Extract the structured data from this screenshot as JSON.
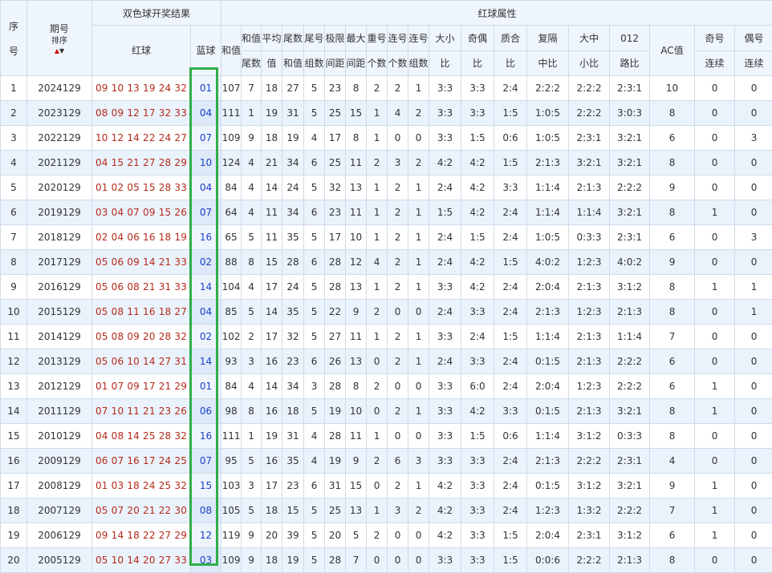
{
  "header": {
    "seq_top": "序",
    "seq_bottom": "号",
    "issue": "期号",
    "sort_label": "排序",
    "draw_result": "双色球开奖结果",
    "red_attr": "红球属性",
    "red_ball": "红球",
    "blue_ball": "蓝球",
    "sum_top": "和值",
    "sum_tail_top": "和值",
    "sum_tail_bottom": "尾数",
    "avg_top": "平均",
    "avg_bottom": "值",
    "tail_sum_top": "尾数",
    "tail_sum_bottom": "和值",
    "tail_group_top": "尾号",
    "tail_group_bottom": "组数",
    "span_top": "极限",
    "span_bottom": "间距",
    "maxgap_top": "最大",
    "maxgap_bottom": "间距",
    "repeat_top": "重号",
    "repeat_bottom": "个数",
    "consec_top": "连号",
    "consec_bottom": "个数",
    "consec_group_top": "连号",
    "consec_group_bottom": "组数",
    "bigsmall_top": "大小",
    "bigsmall_bottom": "比",
    "oddeven_top": "奇偶",
    "oddeven_bottom": "比",
    "primecomp_top": "质合",
    "primecomp_bottom": "比",
    "repeatmid_top": "复隔",
    "repeatmid_bottom": "中比",
    "bigmid_top": "大中",
    "bigmid_bottom": "小比",
    "route_top": "012",
    "route_bottom": "路比",
    "ac": "AC值",
    "oddrun_top": "奇号",
    "oddrun_bottom": "连续",
    "evenrun_top": "偶号",
    "evenrun_bottom": "连续"
  },
  "rows": [
    {
      "seq": "1",
      "issue": "2024129",
      "red": "09 10 13 19 24 32",
      "blue": "01",
      "sum": "107",
      "sum_tail": "7",
      "avg": "18",
      "tail_sum": "27",
      "tail_groups": "5",
      "span": "23",
      "max_gap": "8",
      "repeat": "2",
      "consec": "2",
      "consec_groups": "1",
      "big_small": "3:3",
      "odd_even": "3:3",
      "prime_comp": "2:4",
      "rep_mid": "2:2:2",
      "big_mid_small": "2:2:2",
      "route": "2:3:1",
      "ac": "10",
      "odd_run": "0",
      "even_run": "0"
    },
    {
      "seq": "2",
      "issue": "2023129",
      "red": "08 09 12 17 32 33",
      "blue": "04",
      "sum": "111",
      "sum_tail": "1",
      "avg": "19",
      "tail_sum": "31",
      "tail_groups": "5",
      "span": "25",
      "max_gap": "15",
      "repeat": "1",
      "consec": "4",
      "consec_groups": "2",
      "big_small": "3:3",
      "odd_even": "3:3",
      "prime_comp": "1:5",
      "rep_mid": "1:0:5",
      "big_mid_small": "2:2:2",
      "route": "3:0:3",
      "ac": "8",
      "odd_run": "0",
      "even_run": "0"
    },
    {
      "seq": "3",
      "issue": "2022129",
      "red": "10 12 14 22 24 27",
      "blue": "07",
      "sum": "109",
      "sum_tail": "9",
      "avg": "18",
      "tail_sum": "19",
      "tail_groups": "4",
      "span": "17",
      "max_gap": "8",
      "repeat": "1",
      "consec": "0",
      "consec_groups": "0",
      "big_small": "3:3",
      "odd_even": "1:5",
      "prime_comp": "0:6",
      "rep_mid": "1:0:5",
      "big_mid_small": "2:3:1",
      "route": "3:2:1",
      "ac": "6",
      "odd_run": "0",
      "even_run": "3"
    },
    {
      "seq": "4",
      "issue": "2021129",
      "red": "04 15 21 27 28 29",
      "blue": "10",
      "sum": "124",
      "sum_tail": "4",
      "avg": "21",
      "tail_sum": "34",
      "tail_groups": "6",
      "span": "25",
      "max_gap": "11",
      "repeat": "2",
      "consec": "3",
      "consec_groups": "2",
      "big_small": "4:2",
      "odd_even": "4:2",
      "prime_comp": "1:5",
      "rep_mid": "2:1:3",
      "big_mid_small": "3:2:1",
      "route": "3:2:1",
      "ac": "8",
      "odd_run": "0",
      "even_run": "0"
    },
    {
      "seq": "5",
      "issue": "2020129",
      "red": "01 02 05 15 28 33",
      "blue": "04",
      "sum": "84",
      "sum_tail": "4",
      "avg": "14",
      "tail_sum": "24",
      "tail_groups": "5",
      "span": "32",
      "max_gap": "13",
      "repeat": "1",
      "consec": "2",
      "consec_groups": "1",
      "big_small": "2:4",
      "odd_even": "4:2",
      "prime_comp": "3:3",
      "rep_mid": "1:1:4",
      "big_mid_small": "2:1:3",
      "route": "2:2:2",
      "ac": "9",
      "odd_run": "0",
      "even_run": "0"
    },
    {
      "seq": "6",
      "issue": "2019129",
      "red": "03 04 07 09 15 26",
      "blue": "07",
      "sum": "64",
      "sum_tail": "4",
      "avg": "11",
      "tail_sum": "34",
      "tail_groups": "6",
      "span": "23",
      "max_gap": "11",
      "repeat": "1",
      "consec": "2",
      "consec_groups": "1",
      "big_small": "1:5",
      "odd_even": "4:2",
      "prime_comp": "2:4",
      "rep_mid": "1:1:4",
      "big_mid_small": "1:1:4",
      "route": "3:2:1",
      "ac": "8",
      "odd_run": "1",
      "even_run": "0"
    },
    {
      "seq": "7",
      "issue": "2018129",
      "red": "02 04 06 16 18 19",
      "blue": "16",
      "sum": "65",
      "sum_tail": "5",
      "avg": "11",
      "tail_sum": "35",
      "tail_groups": "5",
      "span": "17",
      "max_gap": "10",
      "repeat": "1",
      "consec": "2",
      "consec_groups": "1",
      "big_small": "2:4",
      "odd_even": "1:5",
      "prime_comp": "2:4",
      "rep_mid": "1:0:5",
      "big_mid_small": "0:3:3",
      "route": "2:3:1",
      "ac": "6",
      "odd_run": "0",
      "even_run": "3"
    },
    {
      "seq": "8",
      "issue": "2017129",
      "red": "05 06 09 14 21 33",
      "blue": "02",
      "sum": "88",
      "sum_tail": "8",
      "avg": "15",
      "tail_sum": "28",
      "tail_groups": "6",
      "span": "28",
      "max_gap": "12",
      "repeat": "4",
      "consec": "2",
      "consec_groups": "1",
      "big_small": "2:4",
      "odd_even": "4:2",
      "prime_comp": "1:5",
      "rep_mid": "4:0:2",
      "big_mid_small": "1:2:3",
      "route": "4:0:2",
      "ac": "9",
      "odd_run": "0",
      "even_run": "0"
    },
    {
      "seq": "9",
      "issue": "2016129",
      "red": "05 06 08 21 31 33",
      "blue": "14",
      "sum": "104",
      "sum_tail": "4",
      "avg": "17",
      "tail_sum": "24",
      "tail_groups": "5",
      "span": "28",
      "max_gap": "13",
      "repeat": "1",
      "consec": "2",
      "consec_groups": "1",
      "big_small": "3:3",
      "odd_even": "4:2",
      "prime_comp": "2:4",
      "rep_mid": "2:0:4",
      "big_mid_small": "2:1:3",
      "route": "3:1:2",
      "ac": "8",
      "odd_run": "1",
      "even_run": "1"
    },
    {
      "seq": "10",
      "issue": "2015129",
      "red": "05 08 11 16 18 27",
      "blue": "04",
      "sum": "85",
      "sum_tail": "5",
      "avg": "14",
      "tail_sum": "35",
      "tail_groups": "5",
      "span": "22",
      "max_gap": "9",
      "repeat": "2",
      "consec": "0",
      "consec_groups": "0",
      "big_small": "2:4",
      "odd_even": "3:3",
      "prime_comp": "2:4",
      "rep_mid": "2:1:3",
      "big_mid_small": "1:2:3",
      "route": "2:1:3",
      "ac": "8",
      "odd_run": "0",
      "even_run": "1"
    },
    {
      "seq": "11",
      "issue": "2014129",
      "red": "05 08 09 20 28 32",
      "blue": "02",
      "sum": "102",
      "sum_tail": "2",
      "avg": "17",
      "tail_sum": "32",
      "tail_groups": "5",
      "span": "27",
      "max_gap": "11",
      "repeat": "1",
      "consec": "2",
      "consec_groups": "1",
      "big_small": "3:3",
      "odd_even": "2:4",
      "prime_comp": "1:5",
      "rep_mid": "1:1:4",
      "big_mid_small": "2:1:3",
      "route": "1:1:4",
      "ac": "7",
      "odd_run": "0",
      "even_run": "0"
    },
    {
      "seq": "12",
      "issue": "2013129",
      "red": "05 06 10 14 27 31",
      "blue": "14",
      "sum": "93",
      "sum_tail": "3",
      "avg": "16",
      "tail_sum": "23",
      "tail_groups": "6",
      "span": "26",
      "max_gap": "13",
      "repeat": "0",
      "consec": "2",
      "consec_groups": "1",
      "big_small": "2:4",
      "odd_even": "3:3",
      "prime_comp": "2:4",
      "rep_mid": "0:1:5",
      "big_mid_small": "2:1:3",
      "route": "2:2:2",
      "ac": "6",
      "odd_run": "0",
      "even_run": "0"
    },
    {
      "seq": "13",
      "issue": "2012129",
      "red": "01 07 09 17 21 29",
      "blue": "01",
      "sum": "84",
      "sum_tail": "4",
      "avg": "14",
      "tail_sum": "34",
      "tail_groups": "3",
      "span": "28",
      "max_gap": "8",
      "repeat": "2",
      "consec": "0",
      "consec_groups": "0",
      "big_small": "3:3",
      "odd_even": "6:0",
      "prime_comp": "2:4",
      "rep_mid": "2:0:4",
      "big_mid_small": "1:2:3",
      "route": "2:2:2",
      "ac": "6",
      "odd_run": "1",
      "even_run": "0"
    },
    {
      "seq": "14",
      "issue": "2011129",
      "red": "07 10 11 21 23 26",
      "blue": "06",
      "sum": "98",
      "sum_tail": "8",
      "avg": "16",
      "tail_sum": "18",
      "tail_groups": "5",
      "span": "19",
      "max_gap": "10",
      "repeat": "0",
      "consec": "2",
      "consec_groups": "1",
      "big_small": "3:3",
      "odd_even": "4:2",
      "prime_comp": "3:3",
      "rep_mid": "0:1:5",
      "big_mid_small": "2:1:3",
      "route": "3:2:1",
      "ac": "8",
      "odd_run": "1",
      "even_run": "0"
    },
    {
      "seq": "15",
      "issue": "2010129",
      "red": "04 08 14 25 28 32",
      "blue": "16",
      "sum": "111",
      "sum_tail": "1",
      "avg": "19",
      "tail_sum": "31",
      "tail_groups": "4",
      "span": "28",
      "max_gap": "11",
      "repeat": "1",
      "consec": "0",
      "consec_groups": "0",
      "big_small": "3:3",
      "odd_even": "1:5",
      "prime_comp": "0:6",
      "rep_mid": "1:1:4",
      "big_mid_small": "3:1:2",
      "route": "0:3:3",
      "ac": "8",
      "odd_run": "0",
      "even_run": "0"
    },
    {
      "seq": "16",
      "issue": "2009129",
      "red": "06 07 16 17 24 25",
      "blue": "07",
      "sum": "95",
      "sum_tail": "5",
      "avg": "16",
      "tail_sum": "35",
      "tail_groups": "4",
      "span": "19",
      "max_gap": "9",
      "repeat": "2",
      "consec": "6",
      "consec_groups": "3",
      "big_small": "3:3",
      "odd_even": "3:3",
      "prime_comp": "2:4",
      "rep_mid": "2:1:3",
      "big_mid_small": "2:2:2",
      "route": "2:3:1",
      "ac": "4",
      "odd_run": "0",
      "even_run": "0"
    },
    {
      "seq": "17",
      "issue": "2008129",
      "red": "01 03 18 24 25 32",
      "blue": "15",
      "sum": "103",
      "sum_tail": "3",
      "avg": "17",
      "tail_sum": "23",
      "tail_groups": "6",
      "span": "31",
      "max_gap": "15",
      "repeat": "0",
      "consec": "2",
      "consec_groups": "1",
      "big_small": "4:2",
      "odd_even": "3:3",
      "prime_comp": "2:4",
      "rep_mid": "0:1:5",
      "big_mid_small": "3:1:2",
      "route": "3:2:1",
      "ac": "9",
      "odd_run": "1",
      "even_run": "0"
    },
    {
      "seq": "18",
      "issue": "2007129",
      "red": "05 07 20 21 22 30",
      "blue": "08",
      "sum": "105",
      "sum_tail": "5",
      "avg": "18",
      "tail_sum": "15",
      "tail_groups": "5",
      "span": "25",
      "max_gap": "13",
      "repeat": "1",
      "consec": "3",
      "consec_groups": "2",
      "big_small": "4:2",
      "odd_even": "3:3",
      "prime_comp": "2:4",
      "rep_mid": "1:2:3",
      "big_mid_small": "1:3:2",
      "route": "2:2:2",
      "ac": "7",
      "odd_run": "1",
      "even_run": "0"
    },
    {
      "seq": "19",
      "issue": "2006129",
      "red": "09 14 18 22 27 29",
      "blue": "12",
      "sum": "119",
      "sum_tail": "9",
      "avg": "20",
      "tail_sum": "39",
      "tail_groups": "5",
      "span": "20",
      "max_gap": "5",
      "repeat": "2",
      "consec": "0",
      "consec_groups": "0",
      "big_small": "4:2",
      "odd_even": "3:3",
      "prime_comp": "1:5",
      "rep_mid": "2:0:4",
      "big_mid_small": "2:3:1",
      "route": "3:1:2",
      "ac": "6",
      "odd_run": "1",
      "even_run": "0"
    },
    {
      "seq": "20",
      "issue": "2005129",
      "red": "05 10 14 20 27 33",
      "blue": "03",
      "sum": "109",
      "sum_tail": "9",
      "avg": "18",
      "tail_sum": "19",
      "tail_groups": "5",
      "span": "28",
      "max_gap": "7",
      "repeat": "0",
      "consec": "0",
      "consec_groups": "0",
      "big_small": "3:3",
      "odd_even": "3:3",
      "prime_comp": "1:5",
      "rep_mid": "0:0:6",
      "big_mid_small": "2:2:2",
      "route": "2:1:3",
      "ac": "8",
      "odd_run": "0",
      "even_run": "0"
    }
  ],
  "colors": {
    "header_bg": "#eef5fc",
    "row_alt_bg": "#eaf2fb",
    "border": "#cfdbe8",
    "red_ball_text": "#b52a1a",
    "blue_ball_text": "#1a40c8",
    "highlight_box": "#2fae49"
  },
  "icons": {
    "sort_up": "red-up-triangle",
    "sort_down": "black-down-triangle"
  }
}
